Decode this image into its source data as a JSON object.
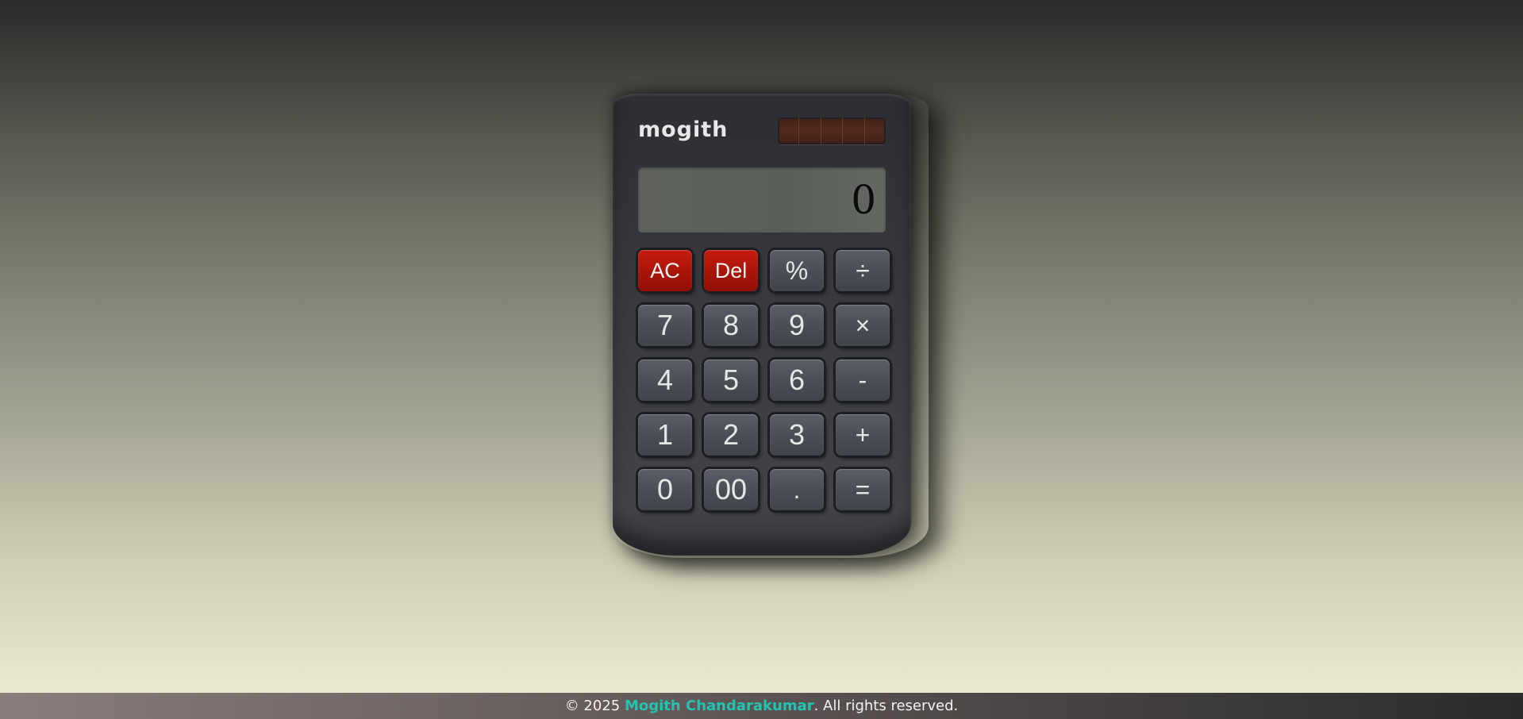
{
  "calculator": {
    "brand": "mogith",
    "display": "0",
    "keys": [
      {
        "label": "AC",
        "name": "all-clear-button",
        "style": "red"
      },
      {
        "label": "Del",
        "name": "delete-button",
        "style": "red"
      },
      {
        "label": "%",
        "name": "percent-button",
        "style": "op"
      },
      {
        "label": "÷",
        "name": "divide-button",
        "style": "op"
      },
      {
        "label": "7",
        "name": "key-7-button",
        "style": "num"
      },
      {
        "label": "8",
        "name": "key-8-button",
        "style": "num"
      },
      {
        "label": "9",
        "name": "key-9-button",
        "style": "num"
      },
      {
        "label": "×",
        "name": "multiply-button",
        "style": "op"
      },
      {
        "label": "4",
        "name": "key-4-button",
        "style": "num"
      },
      {
        "label": "5",
        "name": "key-5-button",
        "style": "num"
      },
      {
        "label": "6",
        "name": "key-6-button",
        "style": "num"
      },
      {
        "label": "-",
        "name": "subtract-button",
        "style": "op"
      },
      {
        "label": "1",
        "name": "key-1-button",
        "style": "num"
      },
      {
        "label": "2",
        "name": "key-2-button",
        "style": "num"
      },
      {
        "label": "3",
        "name": "key-3-button",
        "style": "num"
      },
      {
        "label": "+",
        "name": "add-button",
        "style": "op"
      },
      {
        "label": "0",
        "name": "key-0-button",
        "style": "num"
      },
      {
        "label": "00",
        "name": "key-00-button",
        "style": "num"
      },
      {
        "label": ".",
        "name": "decimal-button",
        "style": "op"
      },
      {
        "label": "=",
        "name": "equals-button",
        "style": "op"
      }
    ]
  },
  "footer": {
    "prefix": "© 2025 ",
    "author": "Mogith Chandarakumar",
    "suffix": ". All rights reserved."
  },
  "colors": {
    "accent": "#22c4b0",
    "key_red": "#b3170b",
    "key_grey": "#4a4f56"
  }
}
